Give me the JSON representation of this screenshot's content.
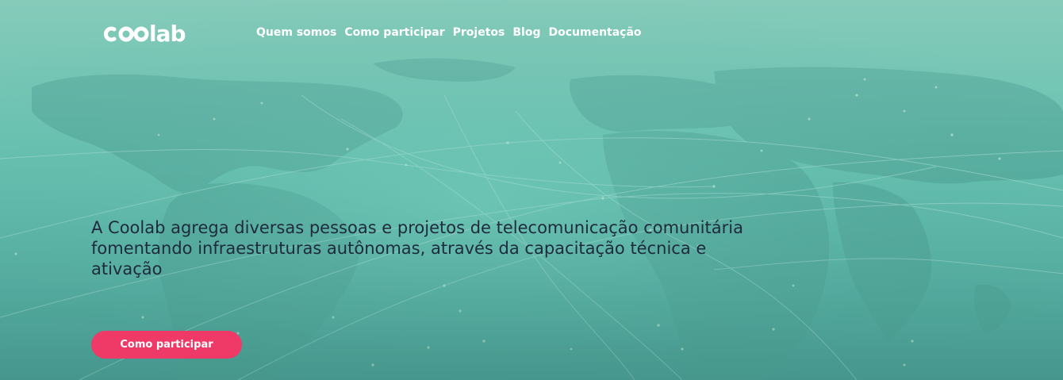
{
  "brand": {
    "logo_text": "coolab",
    "logo_icon": "coolab-logo"
  },
  "nav": {
    "items": [
      {
        "label": "Quem somos"
      },
      {
        "label": "Como participar"
      },
      {
        "label": "Projetos"
      },
      {
        "label": "Blog"
      },
      {
        "label": "Documentação"
      }
    ]
  },
  "hero": {
    "headline": "A Coolab agrega diversas pessoas e projetos de telecomunicação comunitária fomentando infraestruturas autônomas, através da capacitação técnica e ativação",
    "cta_label": "Como participar",
    "background_image": "world-map-network-icon"
  },
  "colors": {
    "teal_overlay": "#6cc3b2",
    "headline_text": "#1f2a3d",
    "cta_background": "#ef3a68",
    "nav_text": "#ffffff"
  }
}
